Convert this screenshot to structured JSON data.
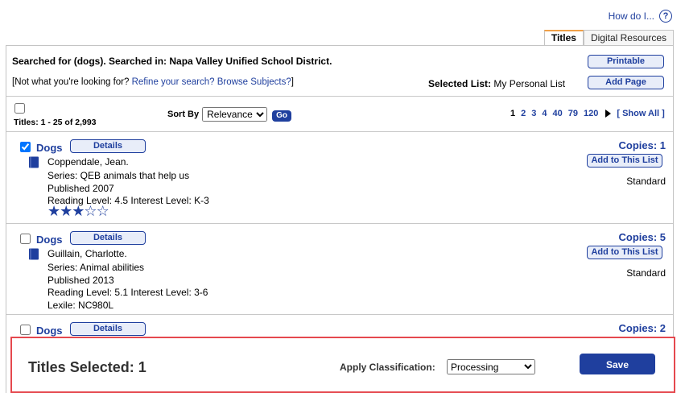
{
  "help": {
    "label": "How do I...",
    "icon": "?"
  },
  "tabs": [
    {
      "label": "Titles",
      "active": true
    },
    {
      "label": "Digital Resources",
      "active": false
    }
  ],
  "search": {
    "summary": "Searched for (dogs). Searched in: Napa Valley Unified School District.",
    "not_found_text": "[Not what you're looking for?",
    "refine_link": "Refine your search?",
    "browse_link": "Browse Subjects?",
    "closing_bracket": "]"
  },
  "selected_list": {
    "label": "Selected List:",
    "value": "My Personal List"
  },
  "buttons": {
    "printable": "Printable",
    "add_page": "Add Page",
    "details": "Details",
    "add_to_list": "Add to This List",
    "go": "Go",
    "save": "Save"
  },
  "results": {
    "count_text": "Titles: 1 - 25 of 2,993"
  },
  "sort": {
    "label": "Sort By",
    "selected": "Relevance"
  },
  "pagination": {
    "current": "1",
    "pages": [
      "2",
      "3",
      "4",
      "40",
      "79",
      "120"
    ],
    "show_all": "[ Show All ]"
  },
  "items": [
    {
      "title": "Dogs",
      "checked": true,
      "author": "Coppendale, Jean.",
      "series": "Series: QEB animals that help us",
      "published": "Published 2007",
      "levels": "Reading Level: 4.5  Interest Level: K-3",
      "copies": "Copies: 1",
      "classification": "Standard",
      "rating": 3,
      "rating_max": 5
    },
    {
      "title": "Dogs",
      "checked": false,
      "author": "Guillain, Charlotte.",
      "series": "Series: Animal abilities",
      "published": "Published 2013",
      "levels": "Reading Level: 5.1  Interest Level: 3-6",
      "lexile": "Lexile: NC980L",
      "copies": "Copies: 5",
      "classification": "Standard"
    },
    {
      "title": "Dogs",
      "checked": false,
      "copies": "Copies: 2"
    }
  ],
  "footer": {
    "titles_selected": "Titles Selected: 1",
    "apply_label": "Apply Classification:",
    "classification_selected": "Processing"
  },
  "colors": {
    "accent": "#1f3f9e",
    "highlight_border": "#e5484e",
    "tab_accent": "#f0a048"
  }
}
